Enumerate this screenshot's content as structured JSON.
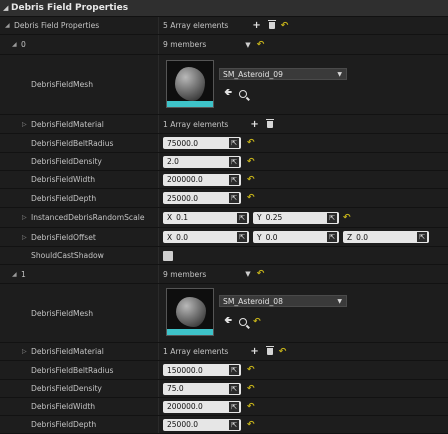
{
  "header": {
    "title": "Debris Field Properties"
  },
  "root": {
    "label": "Debris Field Properties",
    "summary": "5 Array elements"
  },
  "elements": [
    {
      "index": "0",
      "summary": "9 members",
      "mesh": {
        "label": "DebrisFieldMesh",
        "asset": "SM_Asteroid_09"
      },
      "material": {
        "label": "DebrisFieldMaterial",
        "summary": "1 Array elements"
      },
      "belt_radius": {
        "label": "DebrisFieldBeltRadius",
        "value": "75000.0"
      },
      "density": {
        "label": "DebrisFieldDensity",
        "value": "2.0"
      },
      "width": {
        "label": "DebrisFieldWidth",
        "value": "200000.0"
      },
      "depth": {
        "label": "DebrisFieldDepth",
        "value": "25000.0"
      },
      "random_scale": {
        "label": "InstancedDebrisRandomScale",
        "x_label": "X",
        "x": "0.1",
        "y_label": "Y",
        "y": "0.25"
      },
      "offset": {
        "label": "DebrisFieldOffset",
        "x_label": "X",
        "x": "0.0",
        "y_label": "Y",
        "y": "0.0",
        "z_label": "Z",
        "z": "0.0"
      },
      "cast_shadow": {
        "label": "ShouldCastShadow",
        "checked": false
      }
    },
    {
      "index": "1",
      "summary": "9 members",
      "mesh": {
        "label": "DebrisFieldMesh",
        "asset": "SM_Asteroid_08"
      },
      "material": {
        "label": "DebrisFieldMaterial",
        "summary": "1 Array elements"
      },
      "belt_radius": {
        "label": "DebrisFieldBeltRadius",
        "value": "150000.0"
      },
      "density": {
        "label": "DebrisFieldDensity",
        "value": "75.0"
      },
      "width": {
        "label": "DebrisFieldWidth",
        "value": "200000.0"
      },
      "depth": {
        "label": "DebrisFieldDepth",
        "value": "25000.0"
      }
    }
  ],
  "icons": {
    "add": "plus-icon",
    "delete": "trash-icon",
    "reset": "reset-arrow-icon",
    "use": "use-selected-arrow-icon",
    "browse": "browse-magnifier-icon",
    "drag": "drag-handle-icon",
    "collapse": "triangle-icon"
  },
  "colors": {
    "accent_reset": "#c8b51a",
    "thumbnail_base": "#3ec3c9",
    "background": "#1d1d1d"
  }
}
